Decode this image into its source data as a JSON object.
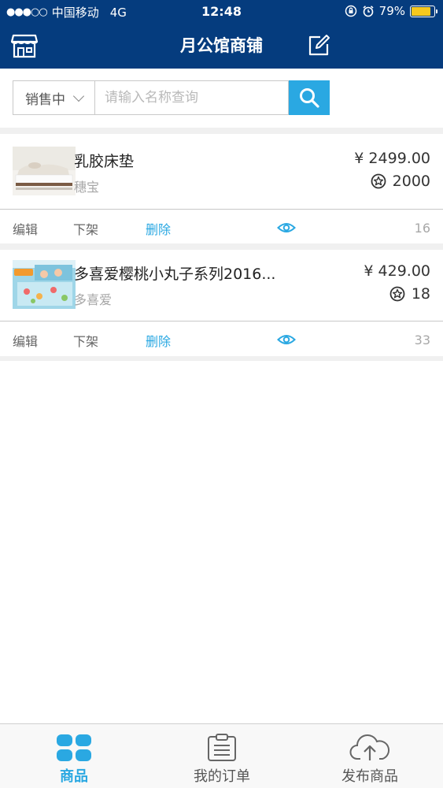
{
  "status_bar": {
    "signal": "●●●○○",
    "carrier": "中国移动",
    "network": "4G",
    "time": "12:48",
    "battery_text": "79%",
    "battery_level": 0.79,
    "battery_color": "#f6c81e"
  },
  "nav": {
    "title": "月公馆商铺",
    "left_icon": "store-icon",
    "right_icon": "edit-icon"
  },
  "search": {
    "filter_value": "销售中",
    "placeholder": "请输入名称查询",
    "button_icon": "search-icon"
  },
  "products": [
    {
      "name": "乳胶床垫",
      "brand": "穗宝",
      "price": "¥ 2499.00",
      "points": "2000",
      "views": "16",
      "actions": {
        "edit": "编辑",
        "offline": "下架",
        "delete": "删除"
      }
    },
    {
      "name": "多喜爱樱桃小丸子系列2016...",
      "brand": "多喜爱",
      "price": "¥ 429.00",
      "points": "18",
      "views": "33",
      "actions": {
        "edit": "编辑",
        "offline": "下架",
        "delete": "删除"
      }
    }
  ],
  "tabbar": {
    "tabs": [
      {
        "label": "商品",
        "icon": "grid-icon",
        "active": true
      },
      {
        "label": "我的订单",
        "icon": "clipboard-icon",
        "active": false
      },
      {
        "label": "发布商品",
        "icon": "cloud-upload-icon",
        "active": false
      }
    ]
  },
  "colors": {
    "header_bg": "#053c7e",
    "accent": "#2aa8e2",
    "divider": "#c8c8c8"
  }
}
